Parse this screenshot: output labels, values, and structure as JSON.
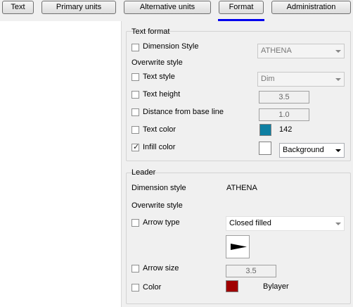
{
  "tabs": [
    {
      "label": "Text"
    },
    {
      "label": "Primary units"
    },
    {
      "label": "Alternative units"
    },
    {
      "label": "Format",
      "active": true
    },
    {
      "label": "Administration"
    }
  ],
  "text_format": {
    "title": "Text format",
    "dimension_style": {
      "label": "Dimension Style",
      "checked": false,
      "value": "ATHENA"
    },
    "overwrite_style": "Overwrite style",
    "text_style": {
      "label": "Text style",
      "checked": false,
      "value": "Dim"
    },
    "text_height": {
      "label": "Text height",
      "checked": false,
      "value": "3.5"
    },
    "distance": {
      "label": "Distance from base line",
      "checked": false,
      "value": "1.0"
    },
    "text_color": {
      "label": "Text color",
      "checked": false,
      "value": "142",
      "color": "#0e7fa2"
    },
    "infill_color": {
      "label": "Infill color",
      "checked": true,
      "value": "Background",
      "color": "#ffffff"
    }
  },
  "leader": {
    "title": "Leader",
    "dimension_style_label": "Dimension style",
    "dimension_style_value": "ATHENA",
    "overwrite_style": "Overwrite style",
    "arrow_type": {
      "label": "Arrow type",
      "checked": false,
      "value": "Closed filled"
    },
    "arrow_size": {
      "label": "Arrow size",
      "checked": false,
      "value": "3.5"
    },
    "color": {
      "label": "Color",
      "checked": false,
      "value": "Bylayer",
      "color": "#a00000"
    }
  },
  "colors": {
    "accent_underline": "#0000ee"
  }
}
